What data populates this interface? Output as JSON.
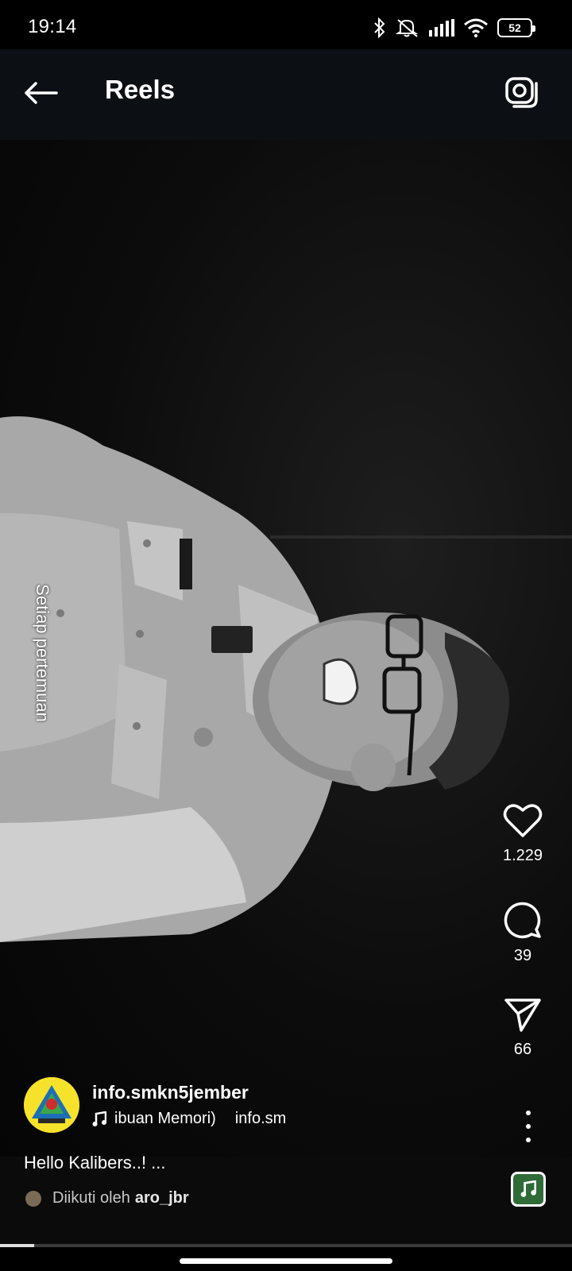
{
  "status_bar": {
    "time": "19:14",
    "battery": "52"
  },
  "header": {
    "title": "Reels"
  },
  "video": {
    "overlay_text": "Setiap pertemuan"
  },
  "actions": {
    "likes": "1.229",
    "comments": "39",
    "shares": "66"
  },
  "author": {
    "username": "info.smkn5jember",
    "audio_title": "ibuan Memori)",
    "audio_handle": "info.sm"
  },
  "caption": "Hello Kalibers..! ...",
  "followed_by": {
    "prefix": "Diikuti oleh",
    "user": "aro_jbr"
  },
  "progress": {
    "fraction": 0.06
  },
  "colors": {
    "top_bar": "#0c1014",
    "logo_yellow": "#f7e22b"
  },
  "icons": [
    "back-arrow-icon",
    "camera-icon",
    "heart-icon",
    "comment-icon",
    "share-icon",
    "more-icon",
    "music-note-icon"
  ]
}
